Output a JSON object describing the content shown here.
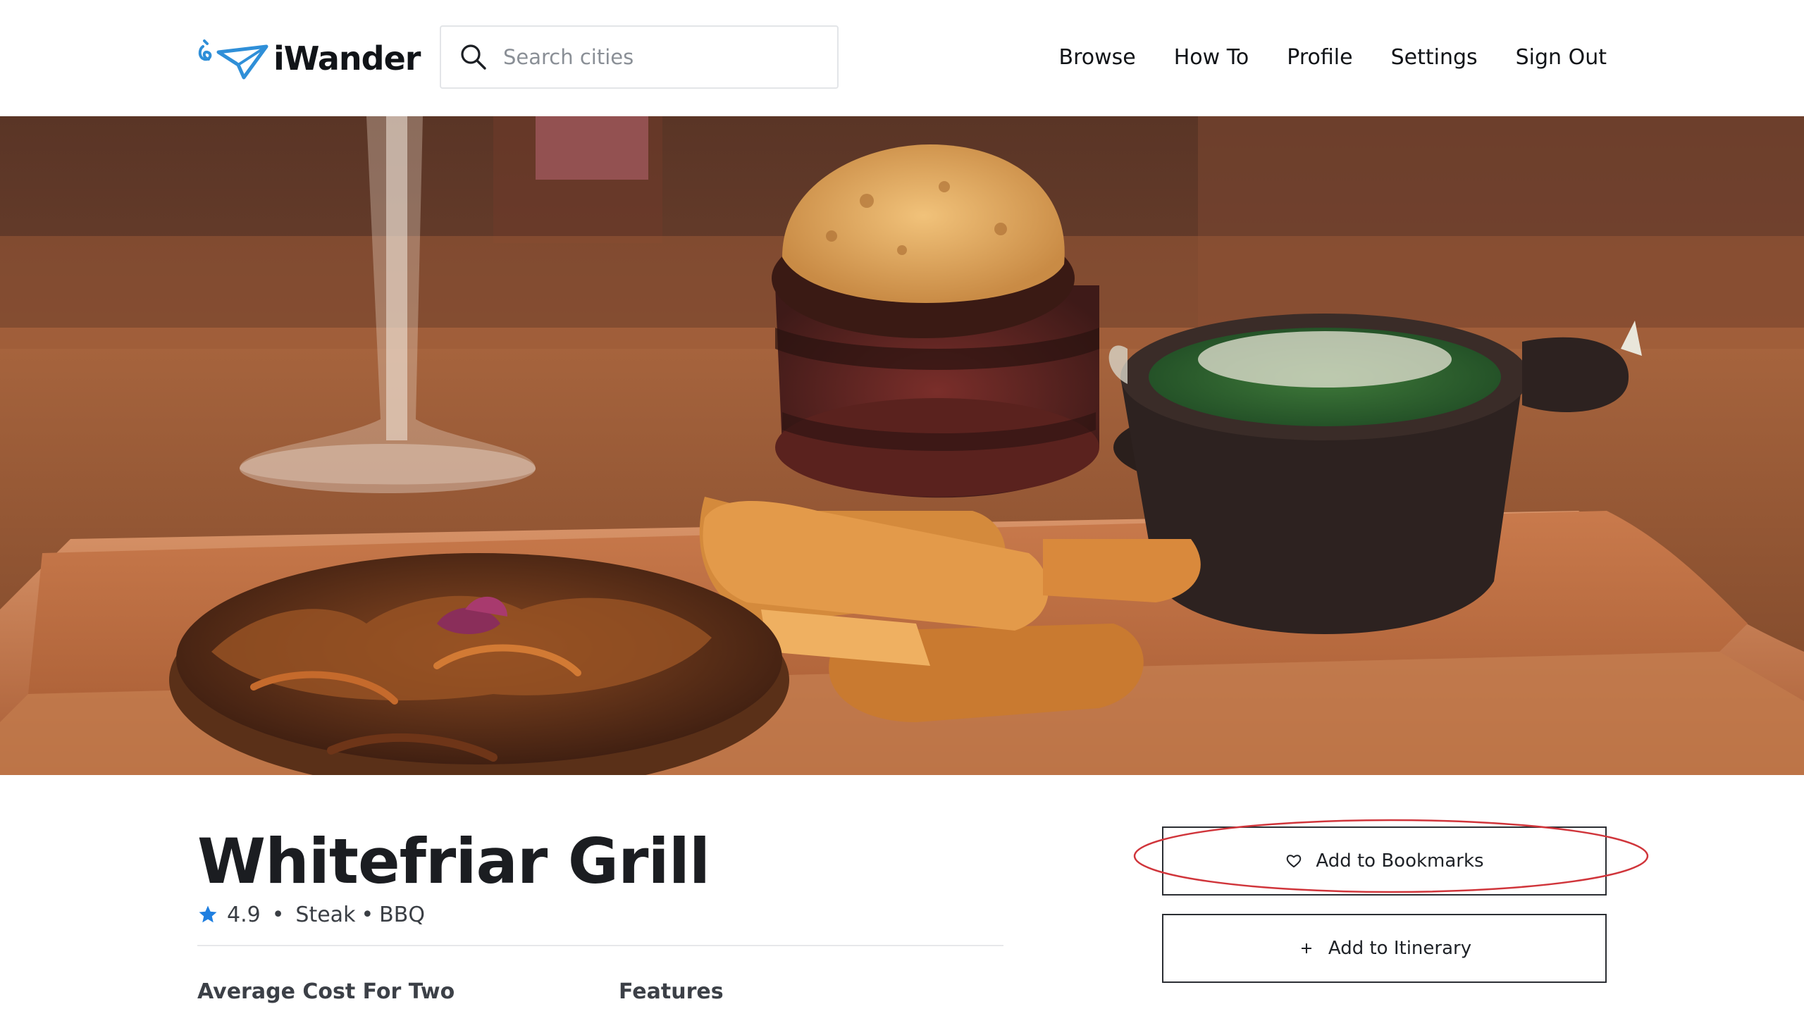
{
  "brand": {
    "name": "iWander",
    "logo_icon": "paper-plane-icon",
    "logo_color": "#2f8fd8"
  },
  "search": {
    "placeholder": "Search cities",
    "value": "",
    "icon": "search-icon"
  },
  "nav": {
    "items": [
      {
        "label": "Browse"
      },
      {
        "label": "How To"
      },
      {
        "label": "Profile"
      },
      {
        "label": "Settings"
      },
      {
        "label": "Sign Out"
      }
    ]
  },
  "hero": {
    "image": "restaurant-dish-photo"
  },
  "restaurant": {
    "name": "Whitefriar Grill",
    "rating": "4.9",
    "rating_icon": "star-icon",
    "rating_color": "#1f7fe0",
    "separator": "•",
    "categories": [
      "Steak",
      "BBQ"
    ]
  },
  "actions": {
    "bookmark_label": "Add to Bookmarks",
    "bookmark_icon": "heart-icon",
    "itinerary_label": "Add to Itinerary",
    "itinerary_icon": "plus-icon",
    "highlight_color": "#d0353b"
  },
  "details": {
    "cost_label": "Average Cost For Two",
    "features_label": "Features"
  }
}
